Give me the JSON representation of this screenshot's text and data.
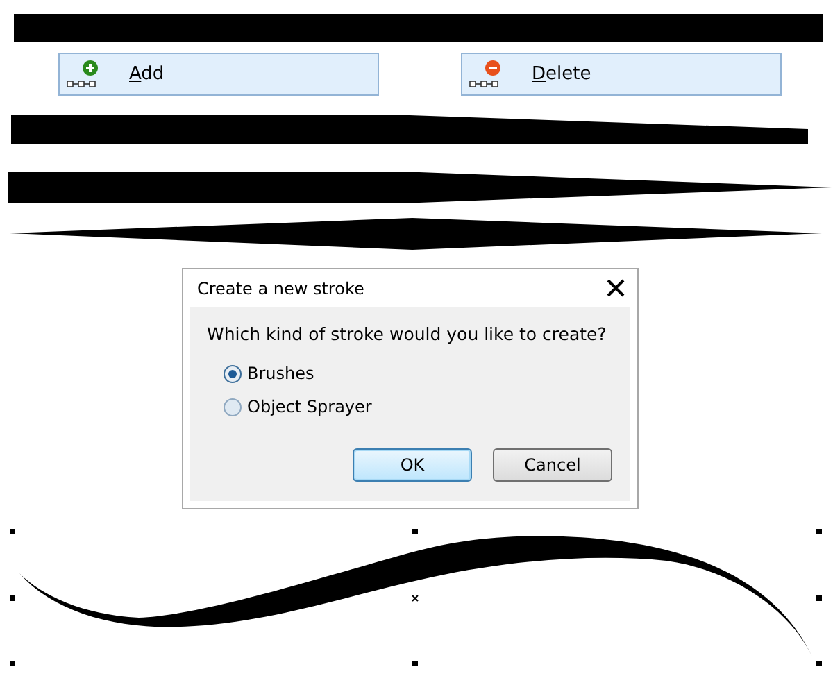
{
  "buttons": [
    {
      "label": "Add",
      "kind": "add"
    },
    {
      "label": "Delete",
      "kind": "delete"
    }
  ],
  "dialog": {
    "title": "Create a new stroke",
    "question": "Which kind of stroke would you like to create?",
    "options": [
      {
        "label": "Brushes",
        "selected": true
      },
      {
        "label": "Object Sprayer",
        "selected": false
      }
    ],
    "buttons": [
      {
        "label": "OK",
        "kind": "default"
      },
      {
        "label": "Cancel",
        "kind": "normal"
      }
    ]
  }
}
